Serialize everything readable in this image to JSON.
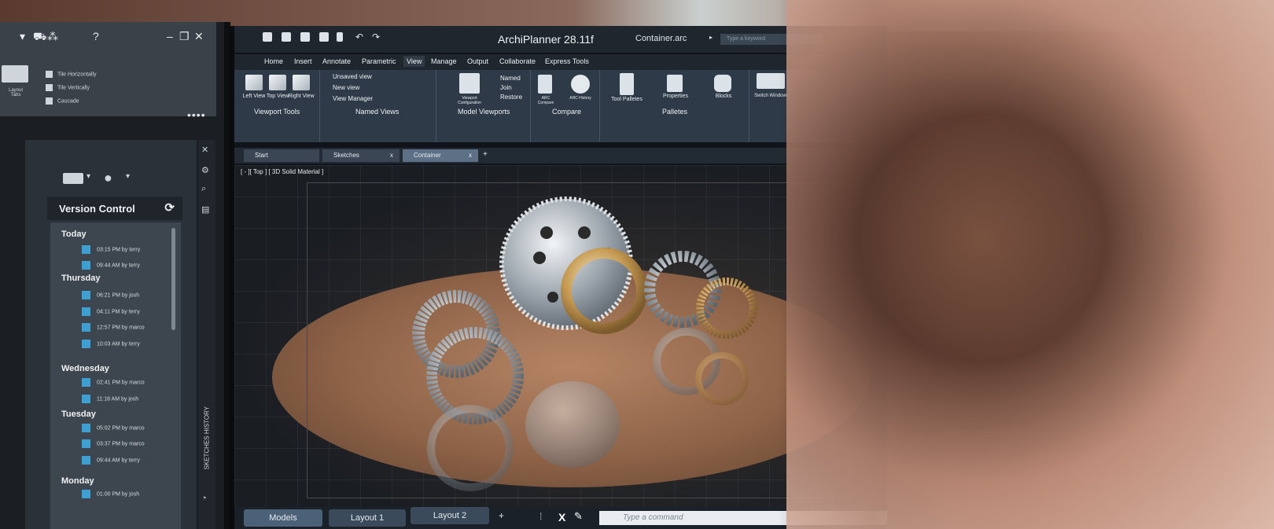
{
  "left_monitor": {
    "tile_options": [
      "Tile Horizontally",
      "Tile Vertically",
      "Cascade"
    ],
    "layout_tabs_label": "Layout Tabs",
    "side_label": "SKETCHES HISTORY",
    "version_control": {
      "title": "Version Control",
      "groups": [
        {
          "day": "Today",
          "items": [
            "03:15 PM by terry",
            "09:44 AM by terry"
          ]
        },
        {
          "day": "Thursday",
          "items": [
            "06:21 PM by josh",
            "04:11 PM by terry",
            "12:57 PM by marco",
            "10:03 AM by terry"
          ]
        },
        {
          "day": "Wednesday",
          "items": [
            "02:41 PM by marco",
            "11:18 AM by josh"
          ]
        },
        {
          "day": "Tuesday",
          "items": [
            "05:02 PM by marco",
            "03:37 PM by marco",
            "09:44 AM by terry"
          ]
        },
        {
          "day": "Monday",
          "items": [
            "01:00 PM by josh"
          ]
        }
      ]
    }
  },
  "main_monitor": {
    "app_title": "ArchiPlanner 28.11f",
    "file_name": "Container.arc",
    "search_placeholder": "Type a keyword",
    "menu": [
      "Home",
      "Insert",
      "Annotate",
      "Parametric",
      "View",
      "Manage",
      "Output",
      "Collaborate",
      "Express Tools"
    ],
    "active_menu": "View",
    "ribbon": {
      "viewport_tools": {
        "label": "Viewport Tools",
        "buttons": [
          "Left View",
          "Top View",
          "Right View"
        ]
      },
      "named_views": {
        "label": "Named Views",
        "items": [
          "Unsaved view",
          "New view",
          "View Manager"
        ]
      },
      "model_viewports": {
        "label": "Model Viewports",
        "button": "Viewport Configuration",
        "items": [
          "Named",
          "Join",
          "Restore"
        ]
      },
      "compare": {
        "label": "Compare",
        "buttons": [
          "ARC Compare",
          "ARC History"
        ]
      },
      "palletes": {
        "label": "Palletes",
        "buttons": [
          "Tool Palletes",
          "Properties",
          "Blocks"
        ]
      },
      "switch": {
        "label": "Switch Windows"
      }
    },
    "doc_tabs": [
      {
        "label": "Start",
        "closable": false
      },
      {
        "label": "Sketches",
        "closable": true
      },
      {
        "label": "Container",
        "closable": true,
        "active": true
      }
    ],
    "close_glyph": "x",
    "add_tab_glyph": "+",
    "viewport_label": "[ - ][ Top ] [ 3D Solid Material ]",
    "layout_tabs": [
      "Models",
      "Layout 1",
      "Layout 2"
    ],
    "active_layout": "Models",
    "command_placeholder": "Type a command",
    "command_x": "X"
  },
  "colors": {
    "ribbon_bg": "#2e3a47",
    "tab_active": "#5d7186",
    "history_icon": "#3f9fd1",
    "plate": "#b58464"
  }
}
